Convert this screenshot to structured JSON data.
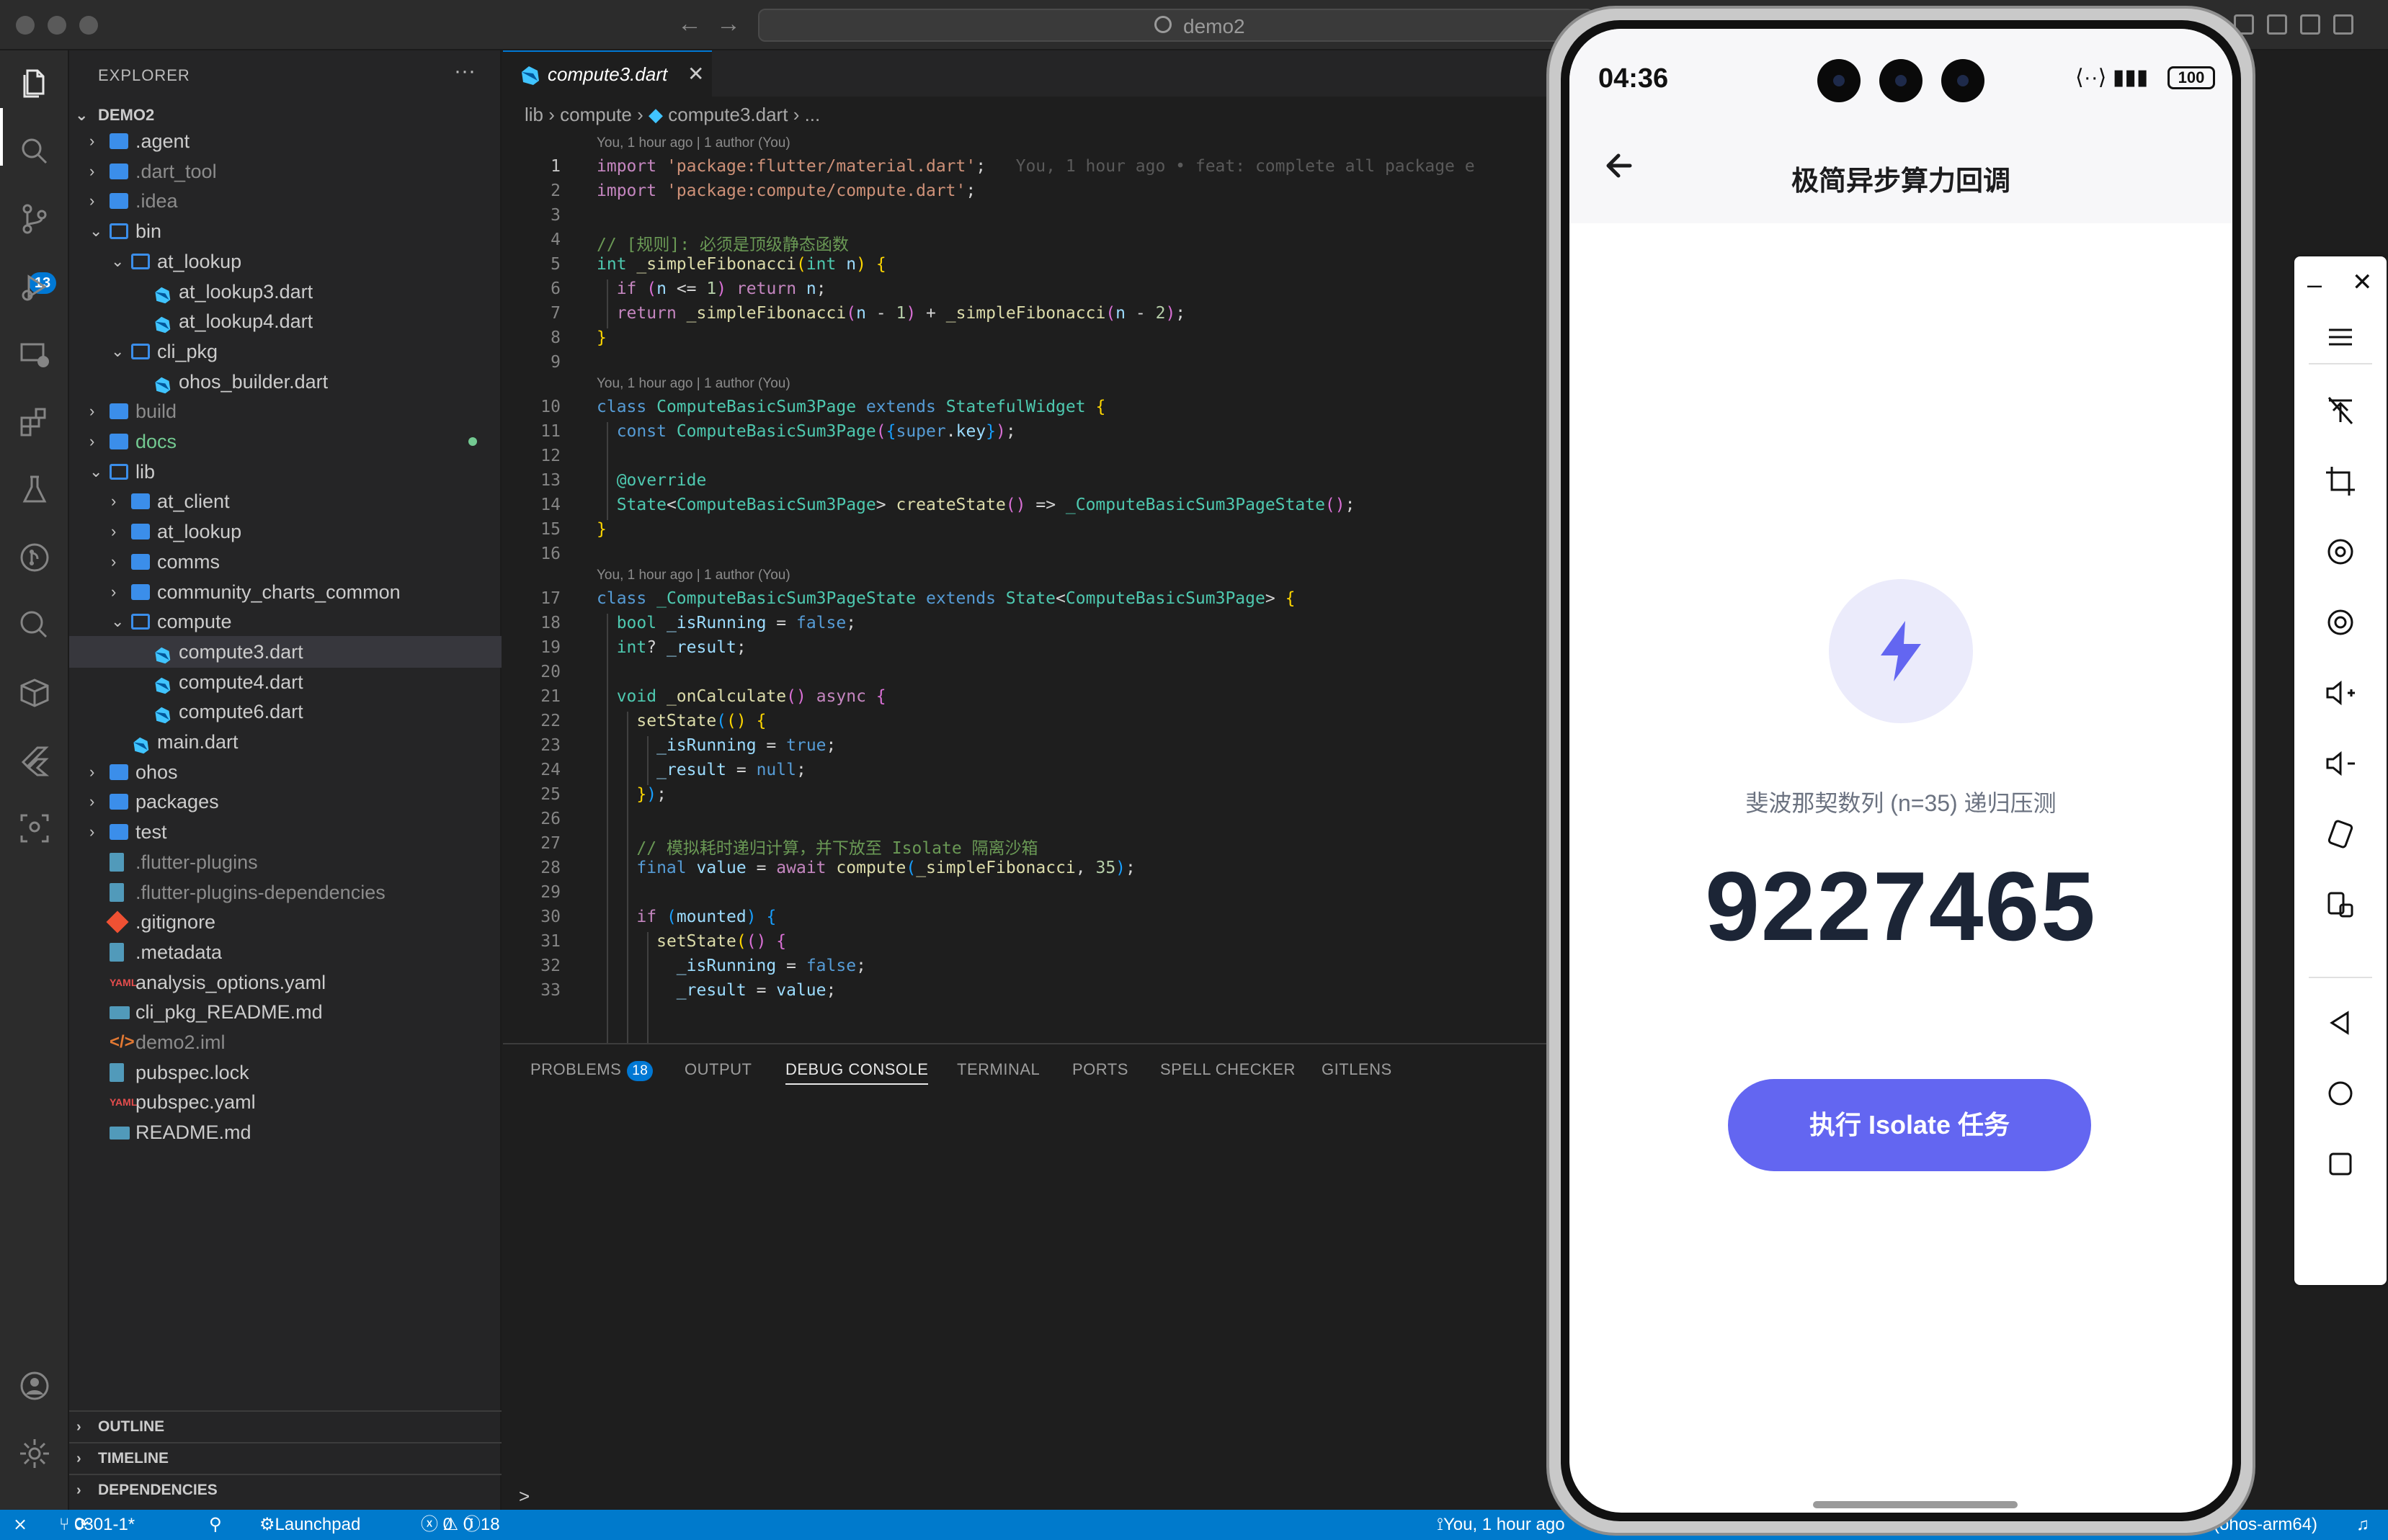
{
  "window": {
    "search_text": "demo2"
  },
  "activity_bar": {
    "scm_badge": "13"
  },
  "explorer": {
    "header": "EXPLORER",
    "more": "···",
    "root": "DEMO2",
    "items": [
      {
        "label": ".agent",
        "kind": "folder",
        "state": "closed",
        "depth": 0,
        "muted": false
      },
      {
        "label": ".dart_tool",
        "kind": "folder",
        "state": "closed",
        "depth": 0,
        "muted": true
      },
      {
        "label": ".idea",
        "kind": "folder",
        "state": "closed",
        "depth": 0,
        "muted": true
      },
      {
        "label": "bin",
        "kind": "folder",
        "state": "open",
        "depth": 0,
        "muted": false
      },
      {
        "label": "at_lookup",
        "kind": "folder",
        "state": "open",
        "depth": 1,
        "muted": false
      },
      {
        "label": "at_lookup3.dart",
        "kind": "dart",
        "depth": 2,
        "muted": false
      },
      {
        "label": "at_lookup4.dart",
        "kind": "dart",
        "depth": 2,
        "muted": false
      },
      {
        "label": "cli_pkg",
        "kind": "folder",
        "state": "open",
        "depth": 1,
        "muted": false
      },
      {
        "label": "ohos_builder.dart",
        "kind": "dart",
        "depth": 2,
        "muted": false
      },
      {
        "label": "build",
        "kind": "folder",
        "state": "closed",
        "depth": 0,
        "muted": true
      },
      {
        "label": "docs",
        "kind": "folder",
        "state": "closed",
        "depth": 0,
        "muted": false,
        "modified": true
      },
      {
        "label": "lib",
        "kind": "folder",
        "state": "open",
        "depth": 0,
        "muted": false
      },
      {
        "label": "at_client",
        "kind": "folder",
        "state": "closed",
        "depth": 1,
        "muted": false
      },
      {
        "label": "at_lookup",
        "kind": "folder",
        "state": "closed",
        "depth": 1,
        "muted": false
      },
      {
        "label": "comms",
        "kind": "folder",
        "state": "closed",
        "depth": 1,
        "muted": false
      },
      {
        "label": "community_charts_common",
        "kind": "folder",
        "state": "closed",
        "depth": 1,
        "muted": false
      },
      {
        "label": "compute",
        "kind": "folder",
        "state": "open",
        "depth": 1,
        "muted": false
      },
      {
        "label": "compute3.dart",
        "kind": "dart",
        "depth": 2,
        "muted": false,
        "selected": true
      },
      {
        "label": "compute4.dart",
        "kind": "dart",
        "depth": 2,
        "muted": false
      },
      {
        "label": "compute6.dart",
        "kind": "dart",
        "depth": 2,
        "muted": false
      },
      {
        "label": "main.dart",
        "kind": "dart",
        "depth": 1,
        "muted": false
      },
      {
        "label": "ohos",
        "kind": "folder",
        "state": "closed",
        "depth": 0,
        "muted": false
      },
      {
        "label": "packages",
        "kind": "folder",
        "state": "closed",
        "depth": 0,
        "muted": false
      },
      {
        "label": "test",
        "kind": "folder",
        "state": "closed",
        "depth": 0,
        "muted": false
      },
      {
        "label": ".flutter-plugins",
        "kind": "doc",
        "depth": 0,
        "muted": true
      },
      {
        "label": ".flutter-plugins-dependencies",
        "kind": "doc",
        "depth": 0,
        "muted": true
      },
      {
        "label": ".gitignore",
        "kind": "git",
        "depth": 0,
        "muted": false
      },
      {
        "label": ".metadata",
        "kind": "doc",
        "depth": 0,
        "muted": false
      },
      {
        "label": "analysis_options.yaml",
        "kind": "yaml",
        "depth": 0,
        "muted": false
      },
      {
        "label": "cli_pkg_README.md",
        "kind": "md",
        "depth": 0,
        "muted": false
      },
      {
        "label": "demo2.iml",
        "kind": "xml",
        "depth": 0,
        "muted": true
      },
      {
        "label": "pubspec.lock",
        "kind": "doc",
        "depth": 0,
        "muted": false
      },
      {
        "label": "pubspec.yaml",
        "kind": "yaml",
        "depth": 0,
        "muted": false
      },
      {
        "label": "README.md",
        "kind": "md",
        "depth": 0,
        "muted": false
      }
    ],
    "sections": [
      "OUTLINE",
      "TIMELINE",
      "DEPENDENCIES"
    ]
  },
  "editor": {
    "tab_label": "compute3.dart",
    "breadcrumb": [
      "lib",
      "compute",
      "compute3.dart",
      "..."
    ],
    "blame_inline": "You, 1 hour ago • feat: complete all package e",
    "codelens": "You, 1 hour ago | 1 author (You)"
  },
  "panel": {
    "tabs": [
      "PROBLEMS",
      "OUTPUT",
      "DEBUG CONSOLE",
      "TERMINAL",
      "PORTS",
      "SPELL CHECKER",
      "GITLENS"
    ],
    "problems_count": "18",
    "active": "DEBUG CONSOLE",
    "prompt": ">"
  },
  "status_bar": {
    "branch": "0301-1*",
    "launchpad": "Launchpad",
    "errors": "0",
    "warnings": "0",
    "infos": "18",
    "blame": "You, 1 hour ago",
    "device": "(ohos-arm64)"
  },
  "phone": {
    "time": "04:36",
    "battery": "100",
    "title": "极简异步算力回调",
    "subtitle": "斐波那契数列 (n=35) 递归压测",
    "result": "9227465",
    "button": "执行 Isolate 任务",
    "accent": "#6366f1"
  }
}
